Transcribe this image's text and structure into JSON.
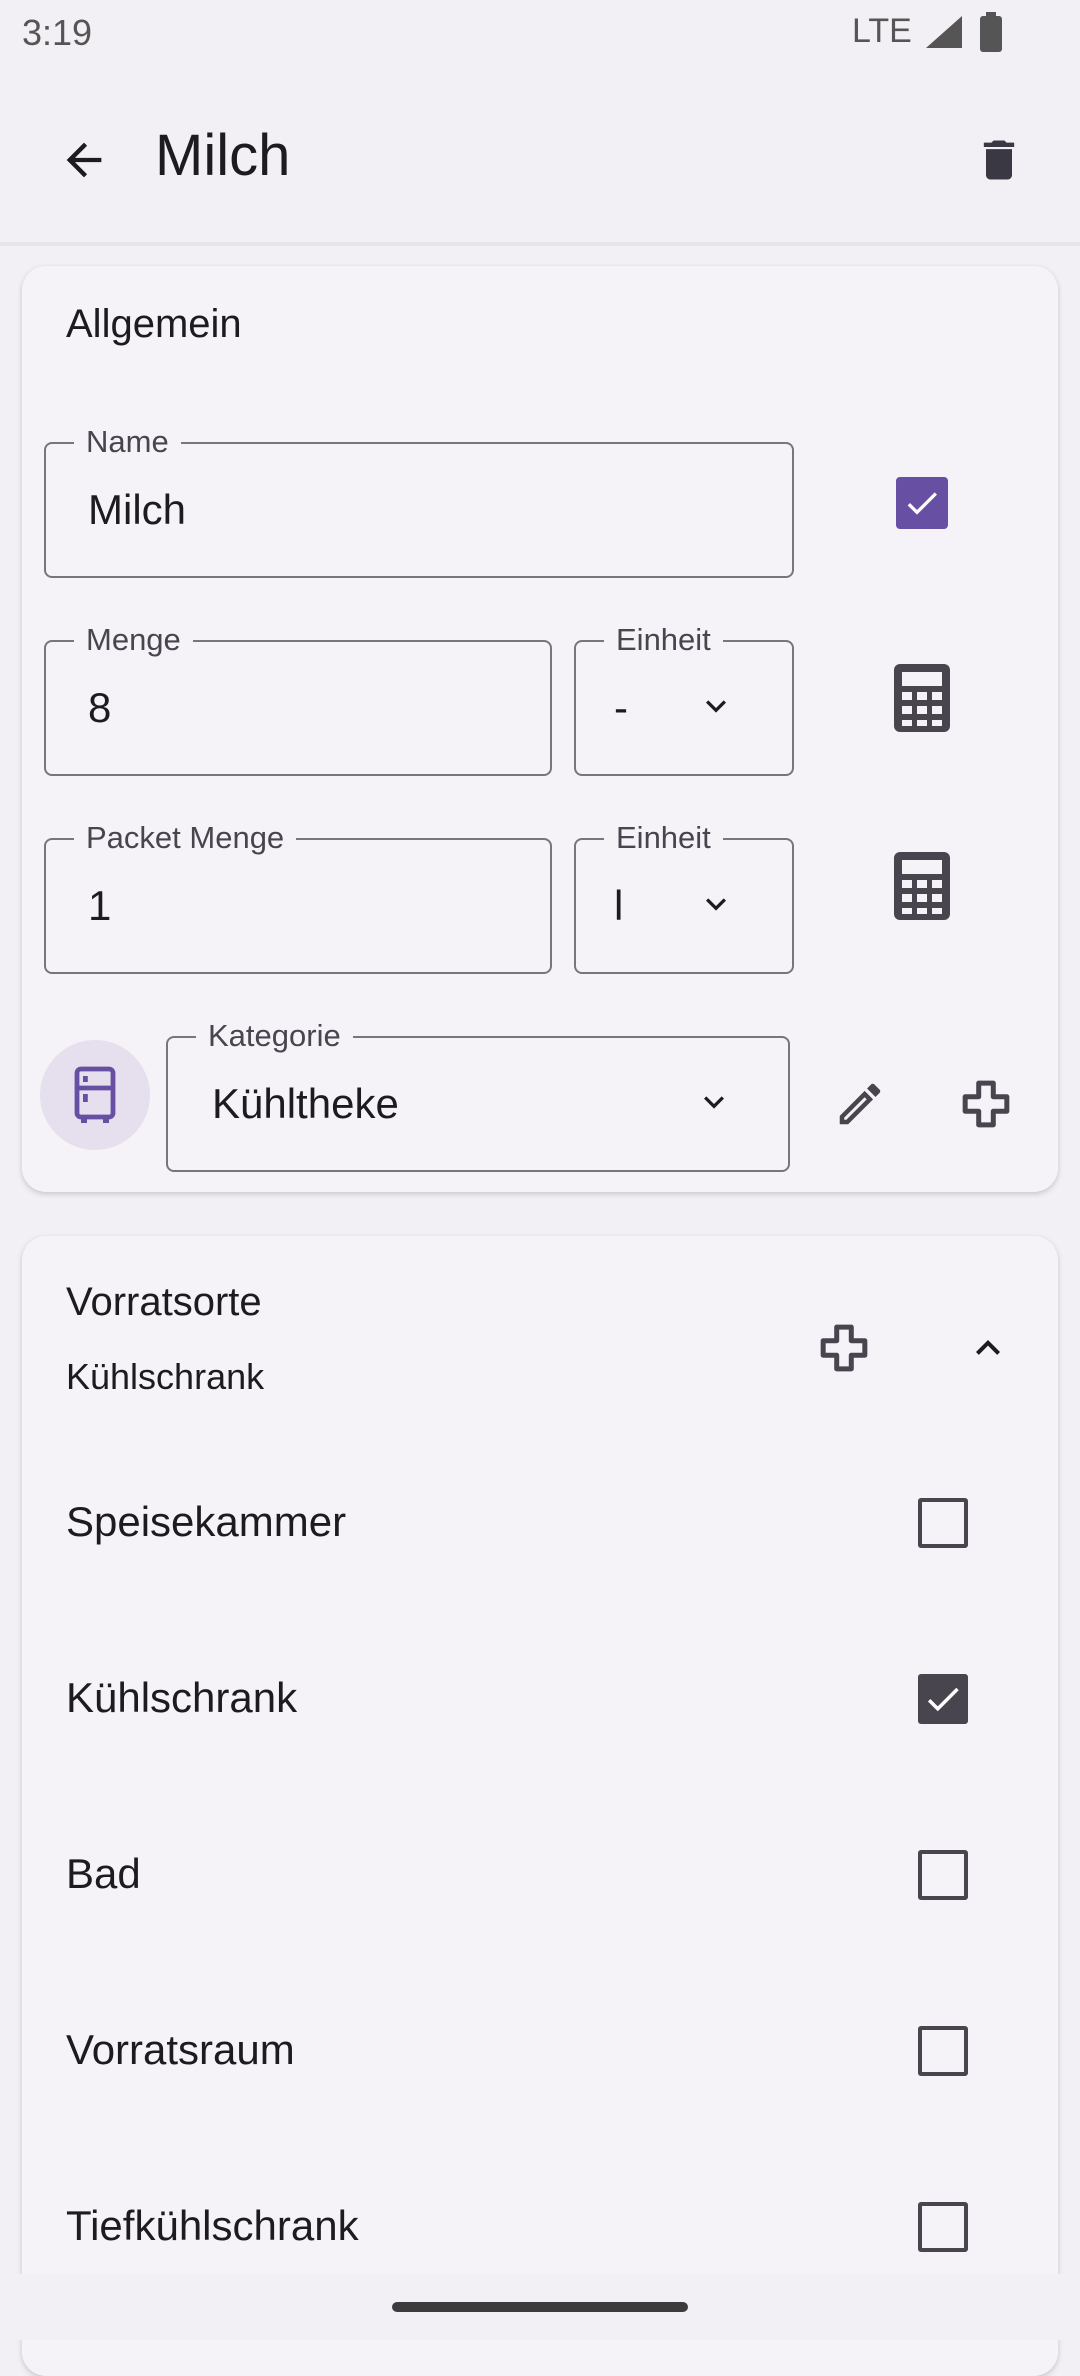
{
  "status_bar": {
    "time": "3:19",
    "network": "LTE"
  },
  "app_bar": {
    "title": "Milch",
    "back_icon": "arrow-back-icon",
    "delete_icon": "trash-icon"
  },
  "general_card": {
    "title": "Allgemein",
    "name_field": {
      "label": "Name",
      "value": "Milch",
      "checkbox_checked": true
    },
    "quantity_field": {
      "label": "Menge",
      "value": "8"
    },
    "quantity_unit": {
      "label": "Einheit",
      "value": "-"
    },
    "package_field": {
      "label": "Packet Menge",
      "value": "1"
    },
    "package_unit": {
      "label": "Einheit",
      "value": "l"
    },
    "category_field": {
      "label": "Kategorie",
      "value": "Kühltheke"
    },
    "category_icon": "fridge-icon"
  },
  "storage_card": {
    "title": "Vorratsorte",
    "subtitle": "Kühlschrank",
    "items": [
      {
        "label": "Speisekammer",
        "checked": false
      },
      {
        "label": "Kühlschrank",
        "checked": true
      },
      {
        "label": "Bad",
        "checked": false
      },
      {
        "label": "Vorratsraum",
        "checked": false
      },
      {
        "label": "Tiefkühlschrank",
        "checked": false
      }
    ]
  },
  "colors": {
    "accent": "#6750a4",
    "background": "#f3f0f5",
    "icon_dark": "#49454f"
  }
}
